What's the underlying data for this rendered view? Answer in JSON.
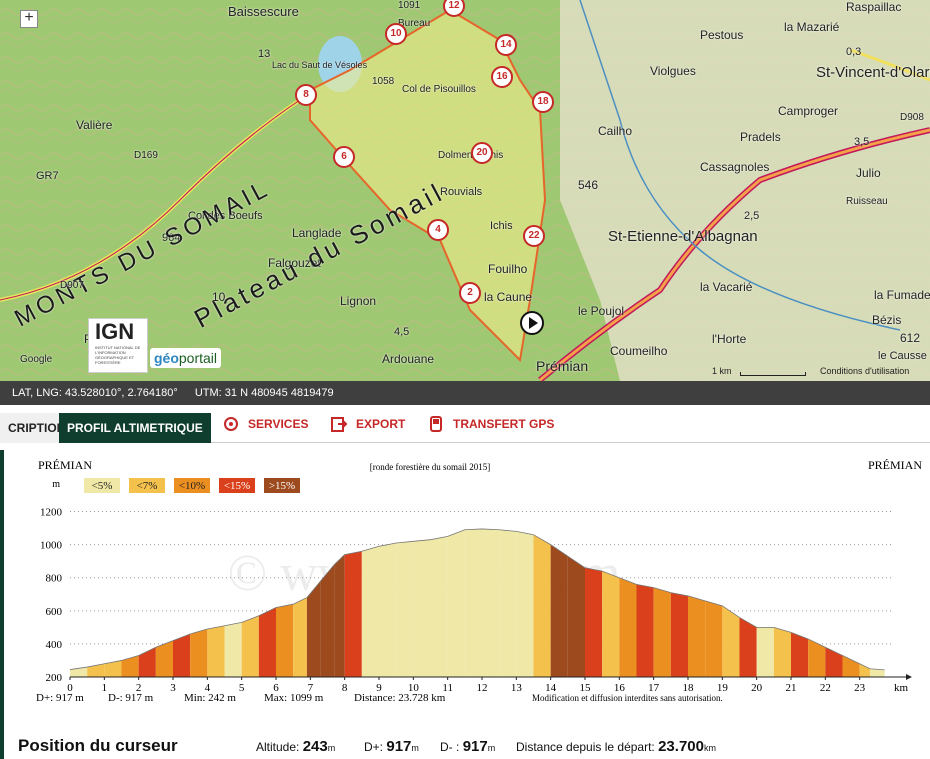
{
  "map": {
    "zoom_in_label": "+",
    "labels": [
      {
        "text": "Baissescure"
      },
      {
        "text": "Lac du Saut de Vésoles"
      },
      {
        "text": "1091"
      },
      {
        "text": "Bureau"
      },
      {
        "text": "1058"
      },
      {
        "text": "Col de Pisouillos"
      },
      {
        "text": "Raspaillac"
      },
      {
        "text": "la Mazarié"
      },
      {
        "text": "Pestous"
      },
      {
        "text": "0,3"
      },
      {
        "text": "St-Vincent-d'Olargues"
      },
      {
        "text": "Violgues"
      },
      {
        "text": "Camproger"
      },
      {
        "text": "Pradels"
      },
      {
        "text": "Valière"
      },
      {
        "text": "Cailho"
      },
      {
        "text": "Dolmen d'Ichis"
      },
      {
        "text": "Cassagnoles"
      },
      {
        "text": "Julio"
      },
      {
        "text": "Rouvials"
      },
      {
        "text": "546"
      },
      {
        "text": "Ichis"
      },
      {
        "text": "Col des Boeufs"
      },
      {
        "text": "964"
      },
      {
        "text": "Langlade"
      },
      {
        "text": "St-Etienne-d'Albagnan"
      },
      {
        "text": "Ruisseau"
      },
      {
        "text": "Falgouzet"
      },
      {
        "text": "Fouilho"
      },
      {
        "text": "la Vacarié"
      },
      {
        "text": "la Fumade"
      },
      {
        "text": "Lignon"
      },
      {
        "text": "la Caune"
      },
      {
        "text": "le Poujol"
      },
      {
        "text": "Bézis"
      },
      {
        "text": "Pardeilhe"
      },
      {
        "text": "Ardouane"
      },
      {
        "text": "Coumeilho"
      },
      {
        "text": "l'Horte"
      },
      {
        "text": "612"
      },
      {
        "text": "le Causse"
      },
      {
        "text": "Prémian"
      },
      {
        "text": "MONTS DU SOMAIL"
      },
      {
        "text": "Plateau du Somail"
      },
      {
        "text": "Google"
      },
      {
        "text": "D169"
      },
      {
        "text": "D907"
      },
      {
        "text": "D908"
      },
      {
        "text": "GR7"
      },
      {
        "text": "4,5"
      },
      {
        "text": "3,5"
      },
      {
        "text": "2,5"
      },
      {
        "text": "13"
      },
      {
        "text": "10"
      }
    ],
    "waypoints": [
      "2",
      "4",
      "6",
      "8",
      "10",
      "12",
      "14",
      "16",
      "18",
      "20",
      "22"
    ],
    "scale_label": "1 km",
    "conditions_label": "Conditions d'utilisation",
    "ign_logo": "IGN",
    "ign_sub": "INSTITUT NATIONAL DE L'INFORMATION GÉOGRAPHIQUE ET FORESTIÈRE",
    "geo_label": "géo",
    "portail_label": "portail"
  },
  "coordbar": {
    "latlng": "LAT, LNG: 43.528010°, 2.764180°",
    "utm": "UTM: 31 N 480945 4819479"
  },
  "tabs": {
    "description": "CRIPTION",
    "profil": "PROFIL ALTIMETRIQUE",
    "services": "SERVICES",
    "export": "EXPORT",
    "transfert": "TRANSFERT GPS"
  },
  "profile": {
    "start_label": "PRÉMIAN",
    "end_label": "PRÉMIAN",
    "center_title": "[ronde forestière du somail 2015]",
    "y_unit": "m",
    "x_unit": "km",
    "legend": [
      {
        "label": "<5%",
        "color": "#efe8a7"
      },
      {
        "label": "<7%",
        "color": "#f5c14d"
      },
      {
        "label": "<10%",
        "color": "#ec8f21"
      },
      {
        "label": "<15%",
        "color": "#d9401b"
      },
      {
        "label": ">15%",
        "color": "#9c4a1e"
      }
    ],
    "stats": {
      "dplus": "D+: 917 m",
      "dminus": "D-: 917 m",
      "min": "Min: 242 m",
      "max": "Max: 1099 m",
      "distance": "Distance: 23.728 km"
    },
    "notice": "Modification et diffusion interdites sans autorisation.",
    "watermark": "© www.o....er.com"
  },
  "chart_data": {
    "type": "area",
    "title": "[ronde forestière du somail 2015]",
    "xlabel": "km",
    "ylabel": "m",
    "xlim": [
      0,
      24
    ],
    "ylim": [
      200,
      1300
    ],
    "yticks": [
      200,
      400,
      600,
      800,
      1000,
      1200
    ],
    "xticks": [
      0,
      1,
      2,
      3,
      4,
      5,
      6,
      7,
      8,
      9,
      10,
      11,
      12,
      13,
      14,
      15,
      16,
      17,
      18,
      19,
      20,
      21,
      22,
      23
    ],
    "x": [
      0,
      0.5,
      1,
      1.5,
      2,
      2.5,
      3,
      3.5,
      4,
      4.5,
      5,
      5.5,
      6,
      6.5,
      6.9,
      7.3,
      7.7,
      8,
      8.5,
      9,
      9.5,
      10,
      10.5,
      11,
      11.5,
      12,
      12.5,
      13,
      13.5,
      14,
      14.5,
      15,
      15.5,
      16,
      16.5,
      17,
      17.5,
      18,
      18.5,
      19,
      19.5,
      20,
      20.5,
      21,
      21.5,
      22,
      22.5,
      23,
      23.3,
      23.728
    ],
    "y": [
      245,
      260,
      280,
      300,
      330,
      380,
      420,
      460,
      490,
      510,
      530,
      570,
      620,
      640,
      680,
      780,
      880,
      940,
      960,
      990,
      1010,
      1020,
      1030,
      1050,
      1090,
      1095,
      1090,
      1080,
      1060,
      1000,
      930,
      860,
      840,
      800,
      760,
      740,
      710,
      690,
      660,
      630,
      560,
      500,
      500,
      470,
      430,
      380,
      330,
      280,
      250,
      243
    ],
    "segment_classes": [
      "<5%",
      "<7%",
      "<7%",
      "<10%",
      "<15%",
      "<10%",
      "<15%",
      "<10%",
      "<7%",
      "<5%",
      "<7%",
      "<15%",
      "<10%",
      "<7%",
      ">15%",
      ">15%",
      ">15%",
      "<15%",
      "<5%",
      "<5%",
      "<5%",
      "<5%",
      "<5%",
      "<5%",
      "<5%",
      "<5%",
      "<5%",
      "<5%",
      "<7%",
      ">15%",
      ">15%",
      "<15%",
      "<7%",
      "<10%",
      "<15%",
      "<10%",
      "<15%",
      "<10%",
      "<10%",
      "<7%",
      "<15%",
      "<5%",
      "<7%",
      "<15%",
      "<10%",
      "<15%",
      "<10%",
      "<7%",
      "<5%"
    ]
  },
  "cursor": {
    "title": "Position du curseur",
    "altitude_label": "Altitude:",
    "altitude_value": "243",
    "dplus_label": "D+:",
    "dplus_value": "917",
    "dminus_label": "D- :",
    "dminus_value": "917",
    "distance_label": "Distance depuis le départ:",
    "distance_value": "23.700",
    "unit_m": "m",
    "unit_km": "km"
  }
}
